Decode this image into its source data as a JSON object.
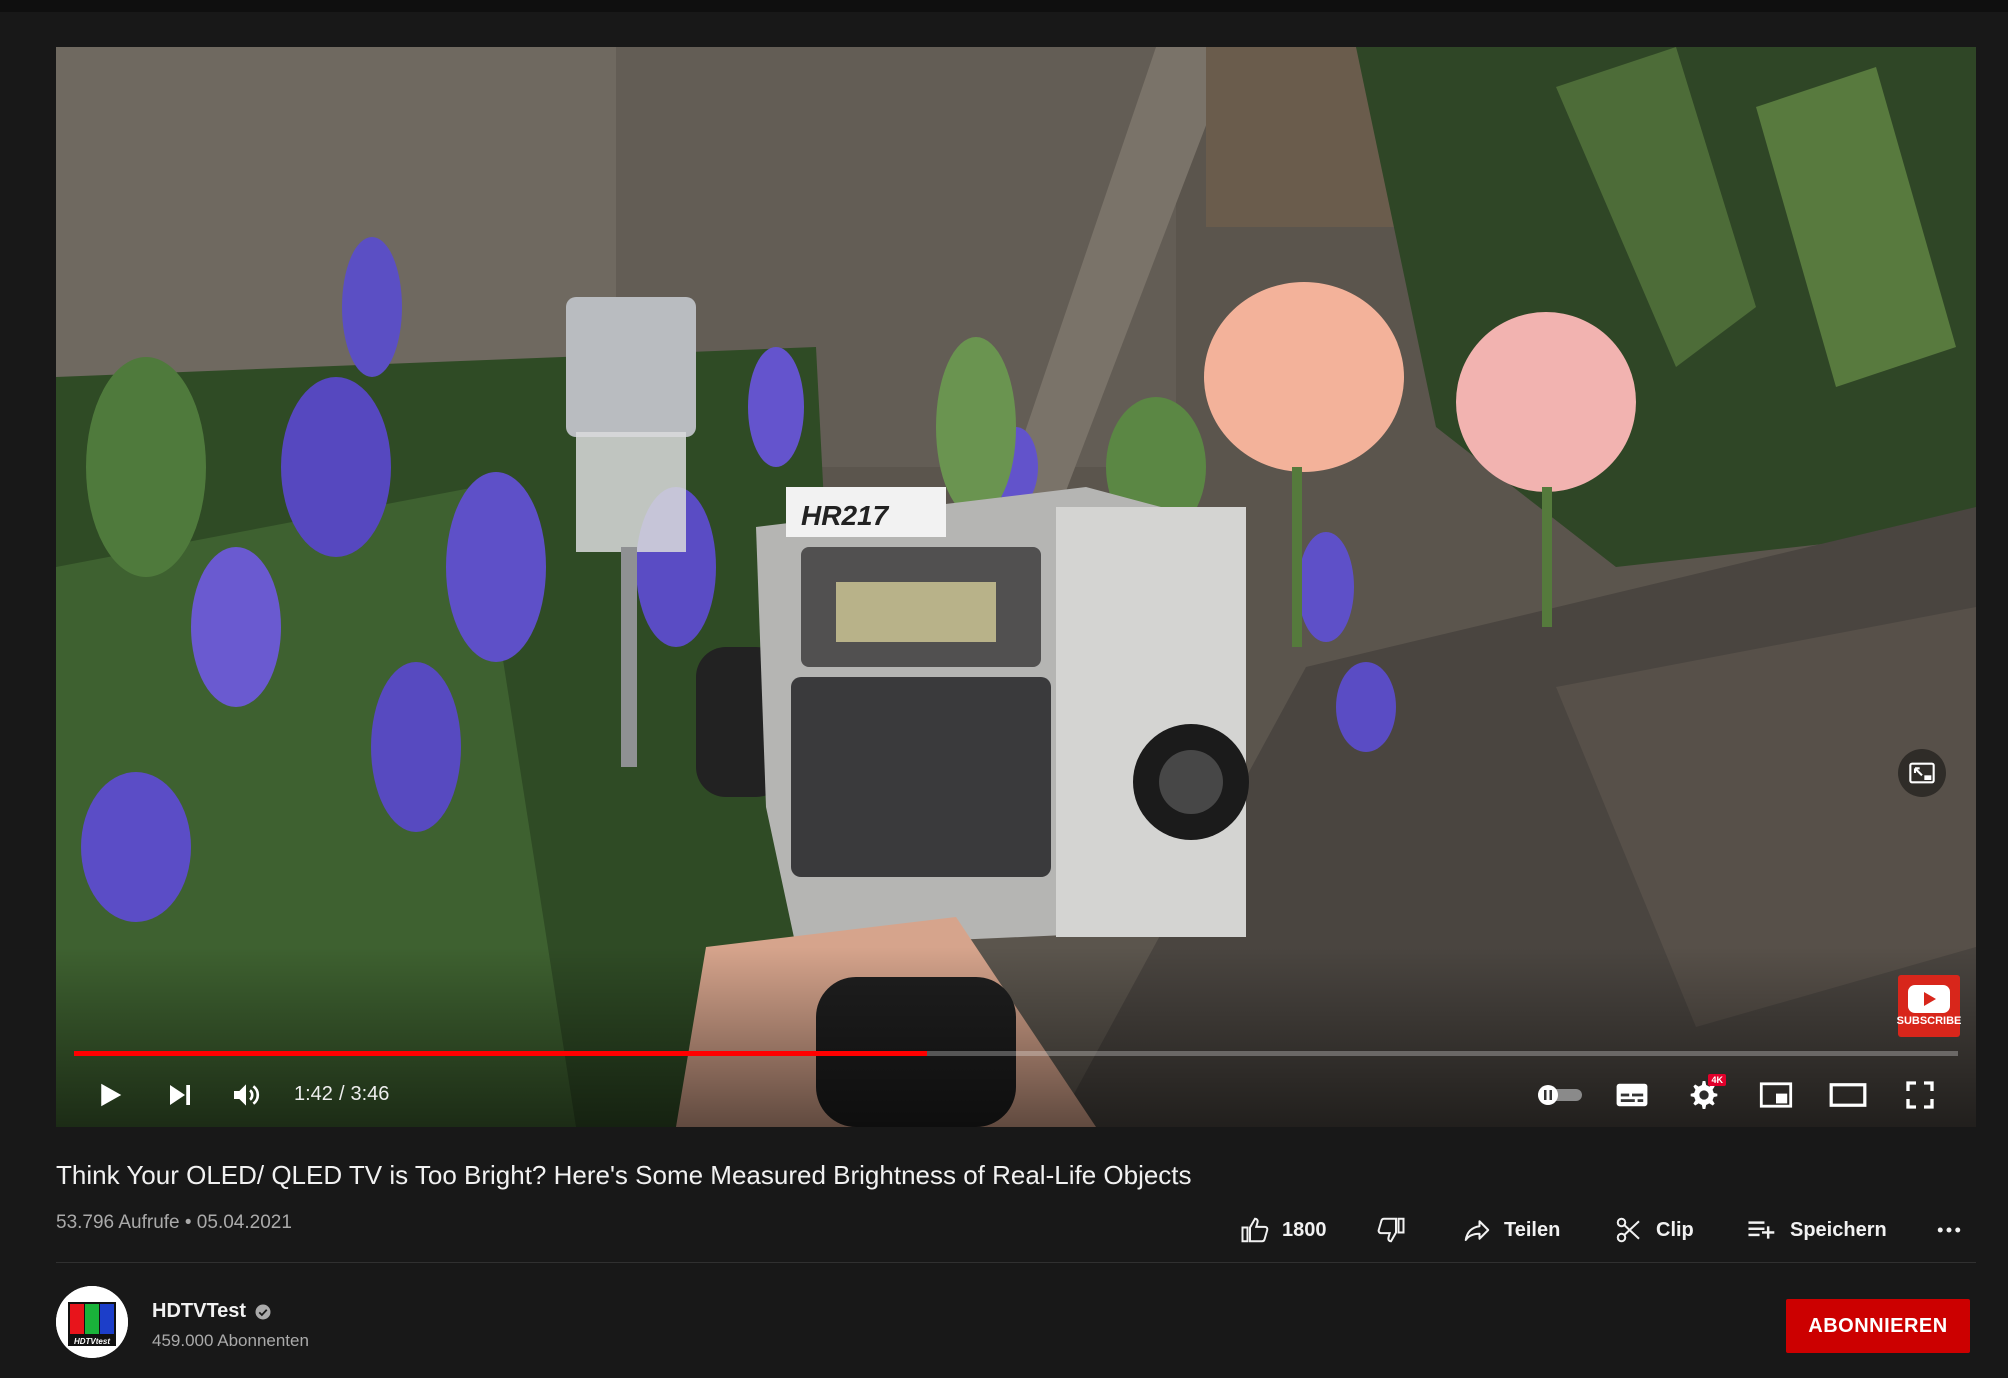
{
  "player": {
    "time_current": "1:42",
    "time_separator": "/",
    "time_total": "3:46",
    "progress_fraction": 0.453,
    "quality_badge": "4K",
    "watermark_label": "SUBSCRIBE",
    "device_label": "HR217",
    "accent_color": "#ff0000"
  },
  "video": {
    "title": "Think Your OLED/ QLED TV is Too Bright? Here's Some Measured Brightness of Real-Life Objects",
    "meta": "53.796 Aufrufe • 05.04.2021"
  },
  "actions": {
    "like_count": "1800",
    "share_label": "Teilen",
    "clip_label": "Clip",
    "save_label": "Speichern"
  },
  "channel": {
    "name": "HDTVTest",
    "subscribers": "459.000 Abonnenten",
    "avatar_label": "HDTVtest",
    "subscribe_label": "ABONNIEREN",
    "subscribe_color": "#cc0000"
  }
}
